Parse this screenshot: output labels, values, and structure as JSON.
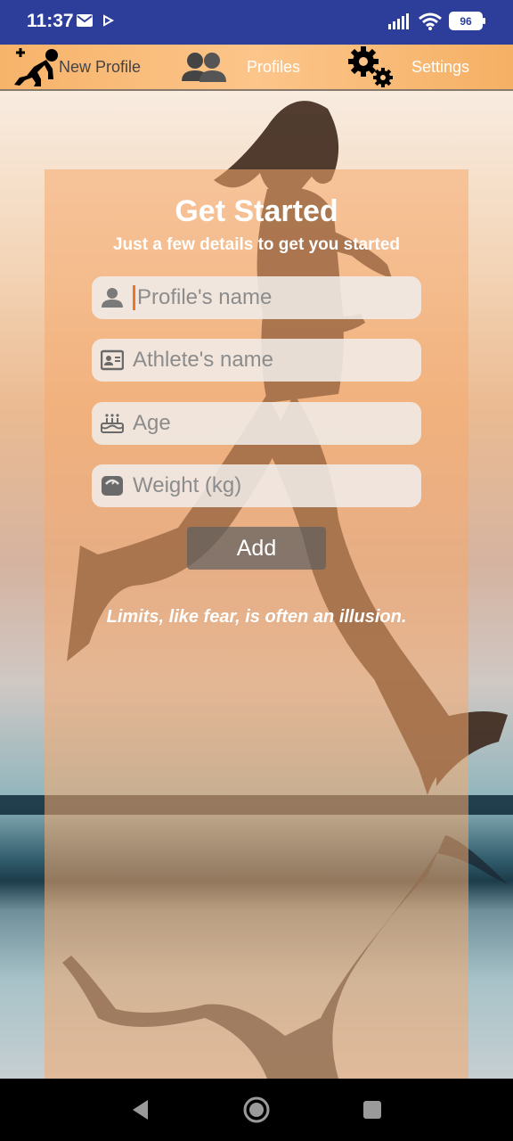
{
  "status_bar": {
    "time": "11:37",
    "battery": "96",
    "icons": [
      "mail-icon",
      "play-icon",
      "signal-icon",
      "wifi-icon",
      "battery-icon"
    ]
  },
  "nav": {
    "new_profile": "New Profile",
    "profiles": "Profiles",
    "settings": "Settings"
  },
  "form": {
    "title": "Get Started",
    "subtitle": "Just a few details to get you started",
    "profile_name_placeholder": "Profile's name",
    "athlete_name_placeholder": "Athlete's name",
    "age_placeholder": "Age",
    "weight_placeholder": "Weight (kg)",
    "add_label": "Add"
  },
  "quote": "Limits, like fear, is often an illusion.",
  "colors": {
    "status_bar": "#2c3e9a",
    "nav_bar": "#fcc58a",
    "card": "#f5aa6e",
    "cursor": "#e8772a"
  }
}
